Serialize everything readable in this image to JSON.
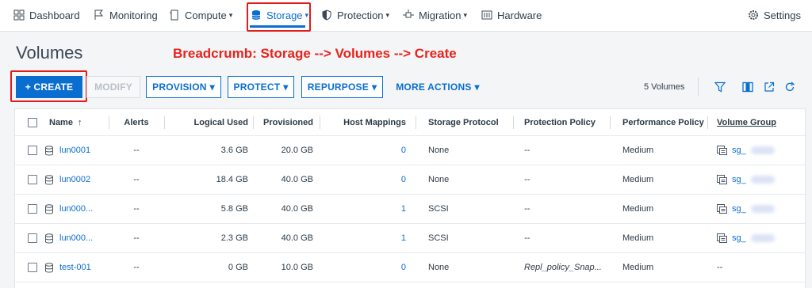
{
  "nav": {
    "dashboard": "Dashboard",
    "monitoring": "Monitoring",
    "compute": "Compute",
    "storage": "Storage",
    "protection": "Protection",
    "migration": "Migration",
    "hardware": "Hardware",
    "settings": "Settings",
    "caret": "▾"
  },
  "page": {
    "title": "Volumes",
    "annotation": "Breadcrumb: Storage --> Volumes --> Create"
  },
  "toolbar": {
    "create": "+ CREATE",
    "modify": "MODIFY",
    "provision": "PROVISION",
    "protect": "PROTECT",
    "repurpose": "REPURPOSE",
    "more_actions": "MORE ACTIONS",
    "caret": "▾",
    "count": "5 Volumes"
  },
  "table": {
    "headers": {
      "name": "Name",
      "sort_arrow": "↑",
      "alerts": "Alerts",
      "logical_used": "Logical Used",
      "provisioned": "Provisioned",
      "host_mappings": "Host Mappings",
      "storage_protocol": "Storage Protocol",
      "protection_policy": "Protection Policy",
      "performance_policy": "Performance Policy",
      "volume_group": "Volume Group"
    },
    "rows": [
      {
        "name": "lun0001",
        "alerts": "--",
        "logical_used": "3.6 GB",
        "provisioned": "20.0 GB",
        "host_mappings": "0",
        "storage_protocol": "None",
        "protection_policy": "--",
        "performance_policy": "Medium",
        "volume_group": "sg_"
      },
      {
        "name": "lun0002",
        "alerts": "--",
        "logical_used": "18.4 GB",
        "provisioned": "40.0 GB",
        "host_mappings": "0",
        "storage_protocol": "None",
        "protection_policy": "--",
        "performance_policy": "Medium",
        "volume_group": "sg_"
      },
      {
        "name": "lun000...",
        "alerts": "--",
        "logical_used": "5.8 GB",
        "provisioned": "40.0 GB",
        "host_mappings": "1",
        "storage_protocol": "SCSI",
        "protection_policy": "--",
        "performance_policy": "Medium",
        "volume_group": "sg_"
      },
      {
        "name": "lun000...",
        "alerts": "--",
        "logical_used": "2.3 GB",
        "provisioned": "40.0 GB",
        "host_mappings": "1",
        "storage_protocol": "SCSI",
        "protection_policy": "--",
        "performance_policy": "Medium",
        "volume_group": "sg_"
      },
      {
        "name": "test-001",
        "alerts": "--",
        "logical_used": "0 GB",
        "provisioned": "10.0 GB",
        "host_mappings": "0",
        "storage_protocol": "None",
        "protection_policy": "Repl_policy_Snap...",
        "performance_policy": "Medium",
        "volume_group": "--"
      }
    ]
  },
  "colors": {
    "accent": "#0a6ed1",
    "annotation_red": "#e8231c"
  },
  "icons": [
    "dashboard-icon",
    "monitoring-flag-icon",
    "compute-icon",
    "storage-database-icon",
    "shield-icon",
    "migration-icon",
    "hardware-icon",
    "gear-icon",
    "filter-icon",
    "columns-icon",
    "export-icon",
    "refresh-icon",
    "volume-icon",
    "volume-group-icon"
  ]
}
